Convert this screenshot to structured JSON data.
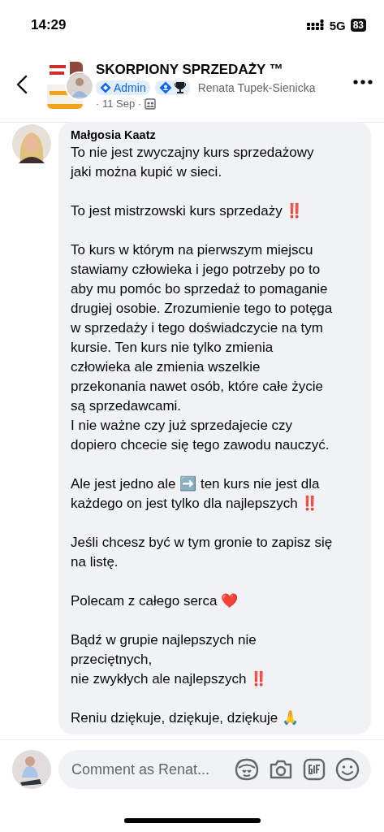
{
  "status_bar": {
    "time": "14:29",
    "network": "5G",
    "battery": "83"
  },
  "header": {
    "group_name": "SKORPIONY SPRZEDAŻY ™",
    "badges": [
      {
        "kind": "admin",
        "label": "Admin"
      },
      {
        "kind": "icons"
      }
    ],
    "author": "Renata Tupek-Sienicka",
    "date": "· 11 Sep ·"
  },
  "comment": {
    "author": "Małgosia Kaatz",
    "paragraphs": [
      [
        "To nie jest zwyczajny kurs sprzedażowy",
        "jaki można kupić w sieci."
      ],
      [
        "To jest mistrzowski kurs sprzedaży ‼️"
      ],
      [
        "To kurs w którym na pierwszym miejscu",
        "stawiamy człowieka i jego potrzeby po to",
        "aby mu pomóc bo sprzedaż to pomaganie",
        "drugiej osobie. Zrozumienie tego to potęga",
        "w sprzedaży i tego doświadczycie na tym",
        "kursie. Ten kurs nie tylko zmienia",
        "człowieka ale zmienia wszelkie",
        "przekonania nawet osób, które całe życie",
        "są sprzedawcami.",
        "I nie ważne czy już sprzedajecie czy",
        "dopiero chcecie się tego zawodu nauczyć."
      ],
      [
        "Ale jest jedno ale ➡️ ten kurs nie jest dla",
        "każdego on jest tylko dla najlepszych ‼️"
      ],
      [
        "Jeśli chcesz być w tym gronie to zapisz się",
        "na listę."
      ],
      [
        "Polecam z całego serca ❤️"
      ],
      [
        "Bądź w grupie najlepszych nie",
        "przeciętnych,",
        "nie zwykłych ale najlepszych ‼️"
      ],
      [
        "Reniu dziękuje, dziękuje, dziękuje 🙏"
      ]
    ]
  },
  "composer": {
    "placeholder": "Comment as Renat..."
  }
}
